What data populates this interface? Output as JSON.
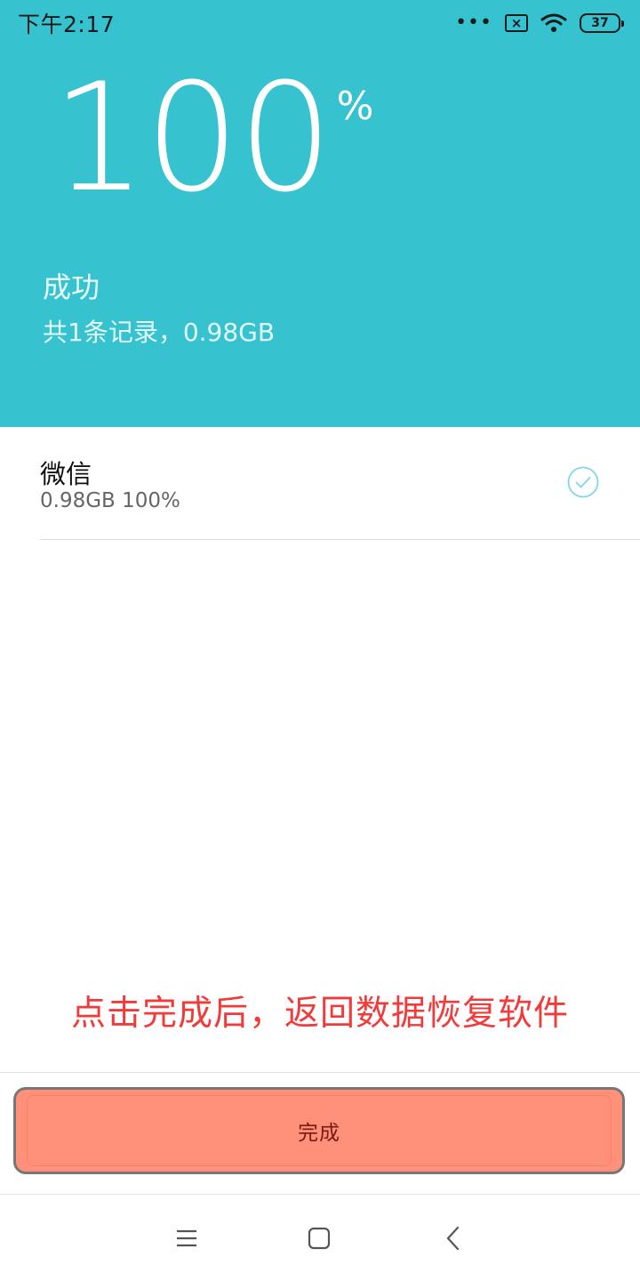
{
  "status_bar": {
    "time": "下午2:17",
    "dots": "•••",
    "sim_icon": "sim-x-icon",
    "wifi_icon": "wifi-icon",
    "battery": "37"
  },
  "header": {
    "percent_value": "100",
    "percent_sign": "%",
    "progress_percent": 100,
    "title": "成功",
    "subtitle": "共1条记录，0.98GB",
    "background_color": "#36c2cf"
  },
  "records": [
    {
      "name": "微信",
      "detail": "0.98GB 100%",
      "status_icon": "check-circle-icon"
    }
  ],
  "annotation": {
    "text": "点击完成后，返回数据恢复软件",
    "color": "#f23a3a"
  },
  "done_button": {
    "label": "完成",
    "color": "#ff907a"
  },
  "nav_bar": {
    "menu_icon": "menu-icon",
    "home_icon": "home-square-icon",
    "back_icon": "back-chevron-icon"
  }
}
